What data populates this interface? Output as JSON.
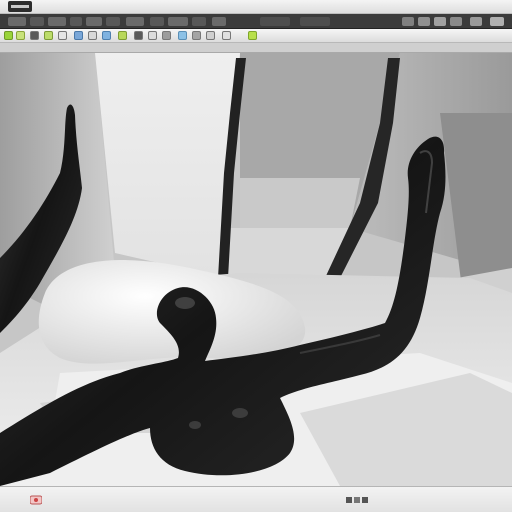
{
  "app": {
    "name": "3d-modeling-app"
  },
  "icons": {
    "app_badge": "app-badge-icon",
    "menu_icons": [
      "minimize-icon",
      "restore-icon",
      "close-icon",
      "help-icon",
      "search-icon",
      "settings-icon",
      "user-icon",
      "home-icon",
      "grid-icon",
      "camera-icon",
      "image-icon"
    ],
    "tool_icons": [
      "select-icon",
      "move-icon",
      "rotate-icon",
      "scale-icon",
      "brush-icon",
      "paint-icon",
      "pen-icon",
      "camera-icon",
      "light-icon",
      "grid-icon",
      "snap-icon",
      "undo-icon",
      "redo-icon",
      "render-icon"
    ]
  },
  "colors": {
    "ui_dark": "#3b3b3b",
    "ui_light": "#e9e9e9",
    "accent_green": "#9ad43a",
    "figure": "#1a1a1a",
    "wall_light": "#e2e2e2"
  },
  "viewport": {
    "label": "perspective-viewport"
  }
}
